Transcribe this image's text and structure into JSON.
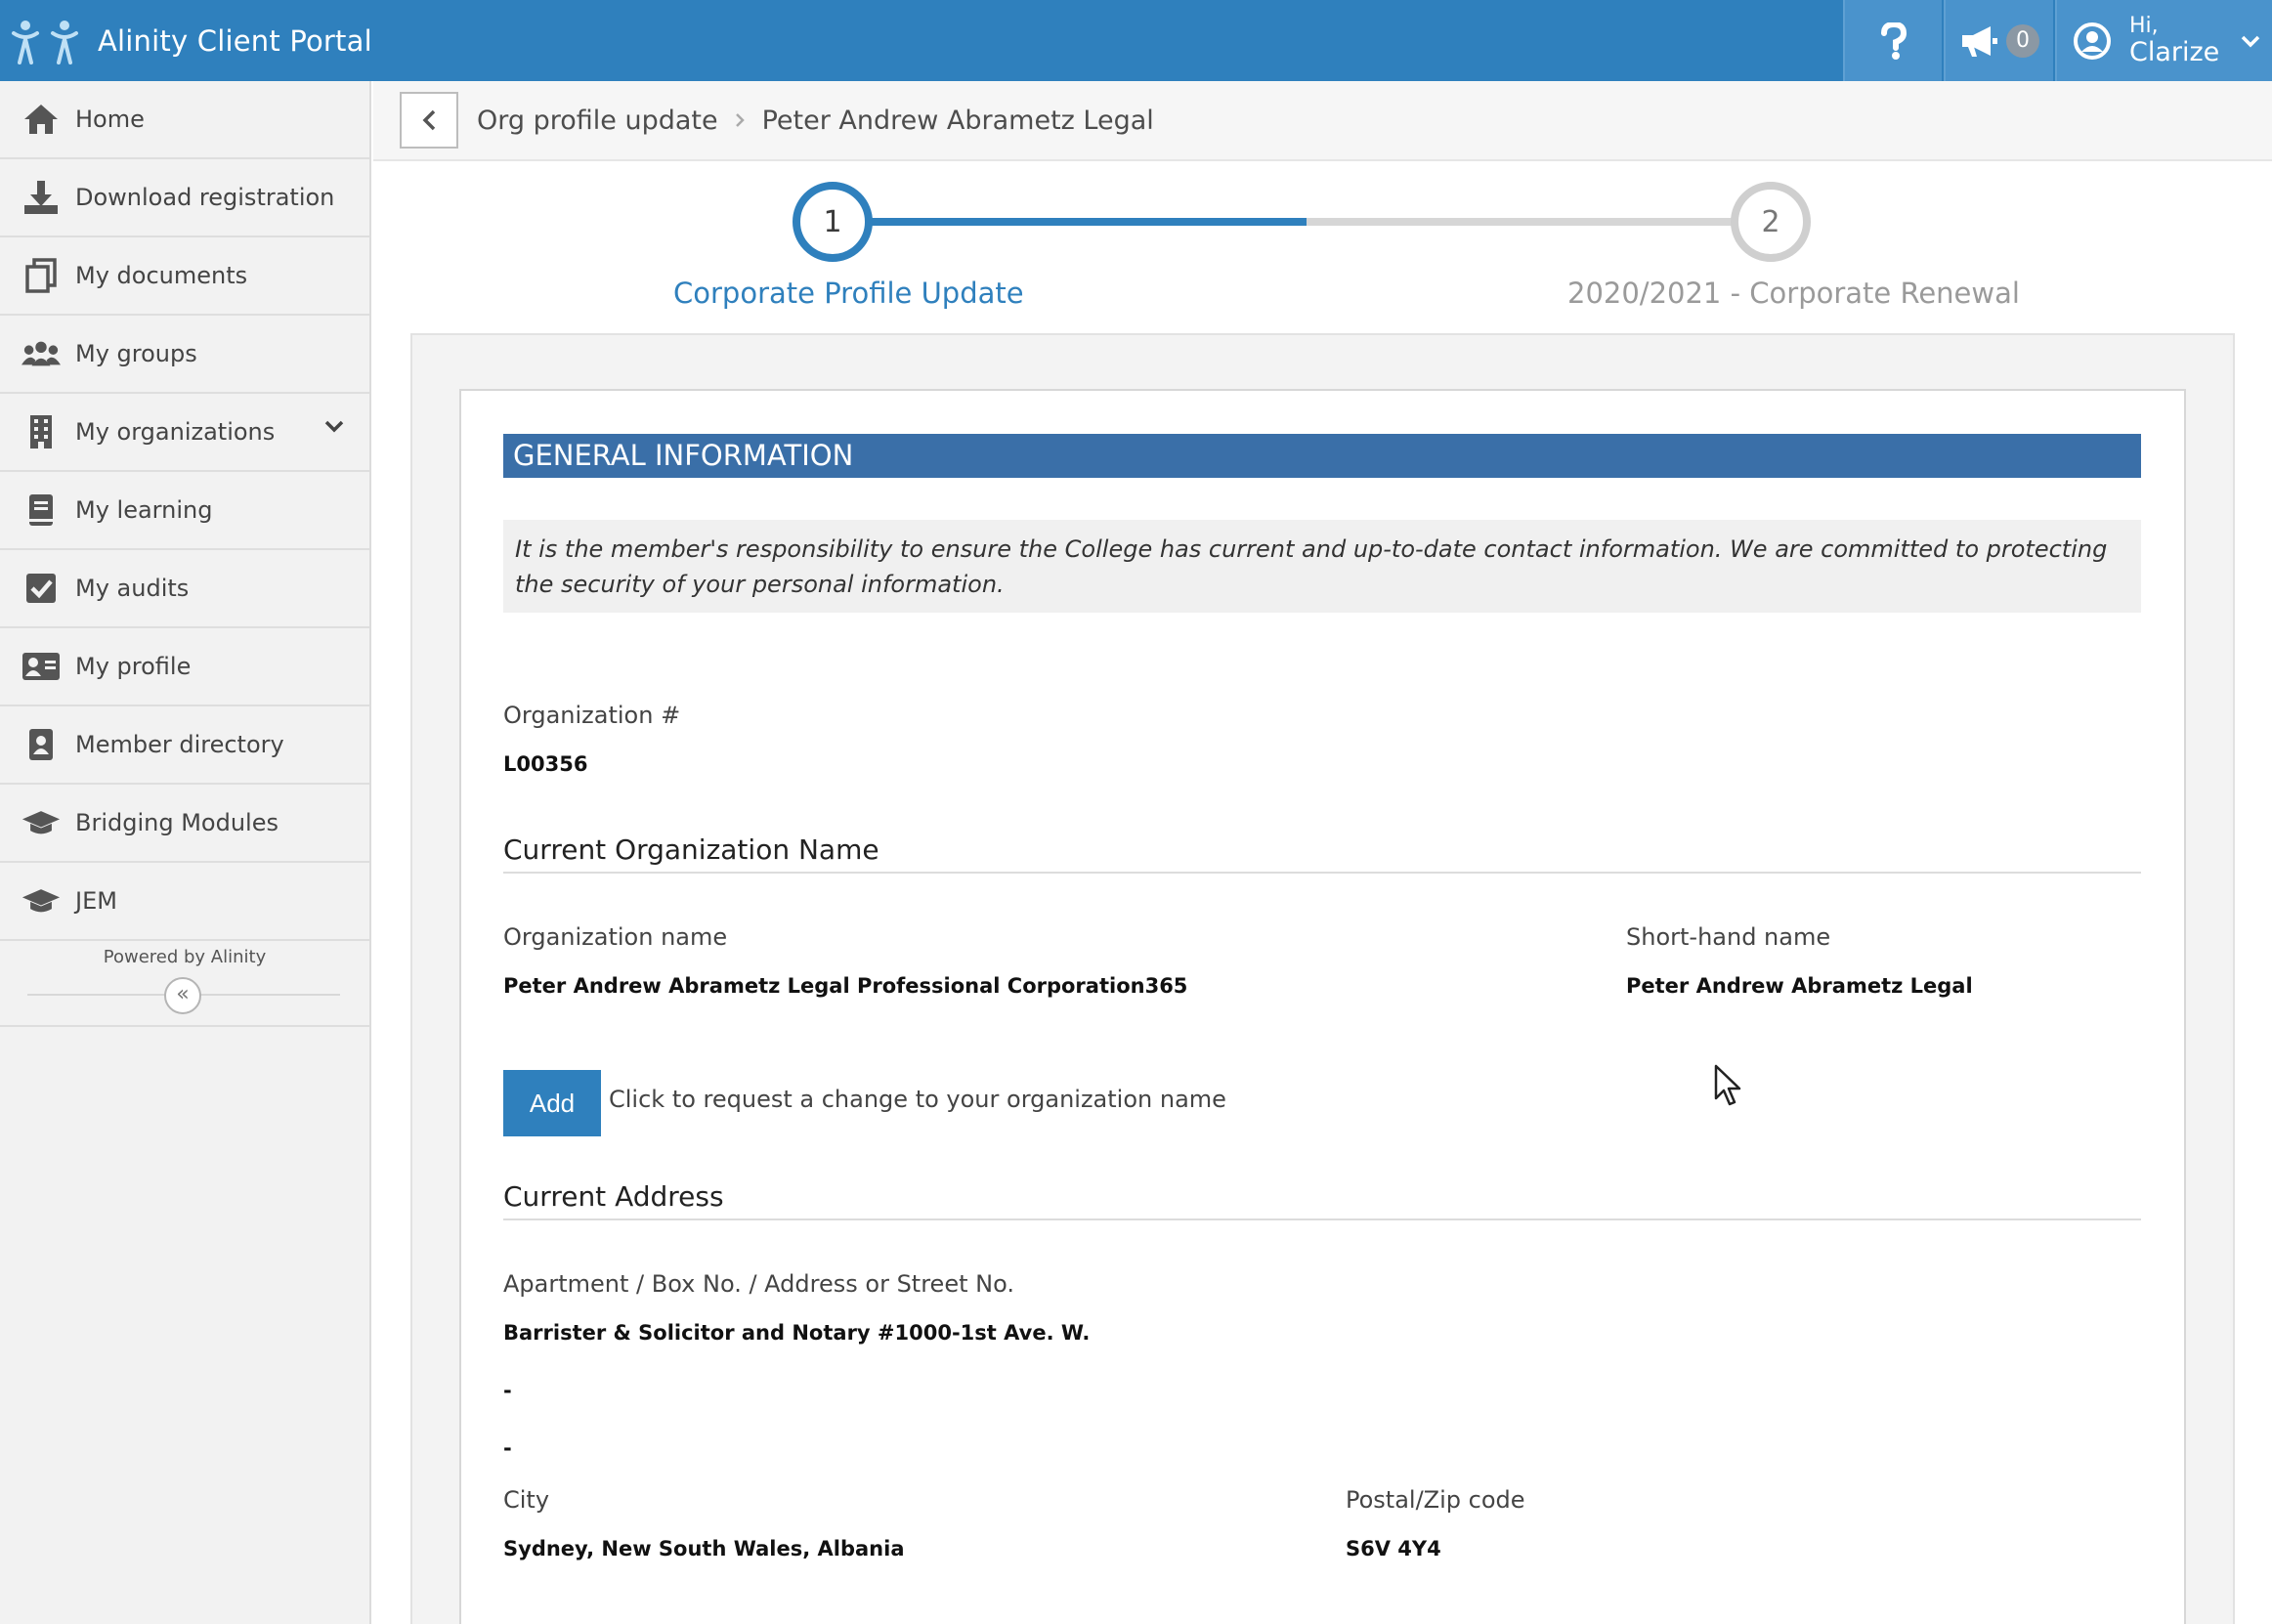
{
  "app": {
    "title": "Alinity Client Portal"
  },
  "topbar": {
    "help_icon": "question-icon",
    "announcements_icon": "megaphone-icon",
    "announcements_count": "0",
    "user_greeting": "Hi,",
    "user_name": "Clarize"
  },
  "sidebar": {
    "items": [
      {
        "label": "Home",
        "icon": "home-icon"
      },
      {
        "label": "Download registration",
        "icon": "download-icon"
      },
      {
        "label": "My documents",
        "icon": "documents-icon"
      },
      {
        "label": "My groups",
        "icon": "groups-icon"
      },
      {
        "label": "My organizations",
        "icon": "building-icon"
      },
      {
        "label": "My learning",
        "icon": "book-icon"
      },
      {
        "label": "My audits",
        "icon": "checkbox-icon"
      },
      {
        "label": "My profile",
        "icon": "id-card-icon"
      },
      {
        "label": "Member directory",
        "icon": "contact-book-icon"
      },
      {
        "label": "Bridging Modules",
        "icon": "graduation-cap-icon"
      },
      {
        "label": "JEM",
        "icon": "graduation-cap-icon"
      }
    ],
    "powered_by": "Powered by Alinity",
    "collapse_glyph": "«"
  },
  "breadcrumb": {
    "items": [
      "Org profile update",
      "Peter Andrew Abrametz Legal"
    ]
  },
  "stepper": {
    "steps": [
      {
        "number": "1",
        "label": "Corporate Profile Update"
      },
      {
        "number": "2",
        "label": "2020/2021 - Corporate Renewal"
      }
    ],
    "progress": 0.5
  },
  "form": {
    "section_title": "GENERAL INFORMATION",
    "notice": "It is the member's responsibility to ensure the College has current and up-to-date contact information. We are committed to protecting the security of your personal information.",
    "org_number_label": "Organization #",
    "org_number_value": "L00356",
    "current_name_heading": "Current Organization Name",
    "org_name_label": "Organization name",
    "org_name_value": "Peter Andrew Abrametz Legal Professional Corporation365",
    "short_name_label": "Short-hand name",
    "short_name_value": "Peter Andrew Abrametz Legal",
    "add_button": "Add",
    "add_hint": "Click to request a change to your organization name",
    "current_address_heading": "Current Address",
    "address_label": "Apartment / Box No. / Address or Street No.",
    "address_line1": "Barrister & Solicitor and Notary #1000-1st Ave. W.",
    "address_line2": "-",
    "address_line3": "-",
    "city_label": "City",
    "city_value": "Sydney, New South Wales, Albania",
    "postal_label": "Postal/Zip code",
    "postal_value": "S6V 4Y4"
  },
  "colors": {
    "topbar": "#2f80bd",
    "section_header": "#3a6fa8",
    "accent": "#2f80bd"
  }
}
